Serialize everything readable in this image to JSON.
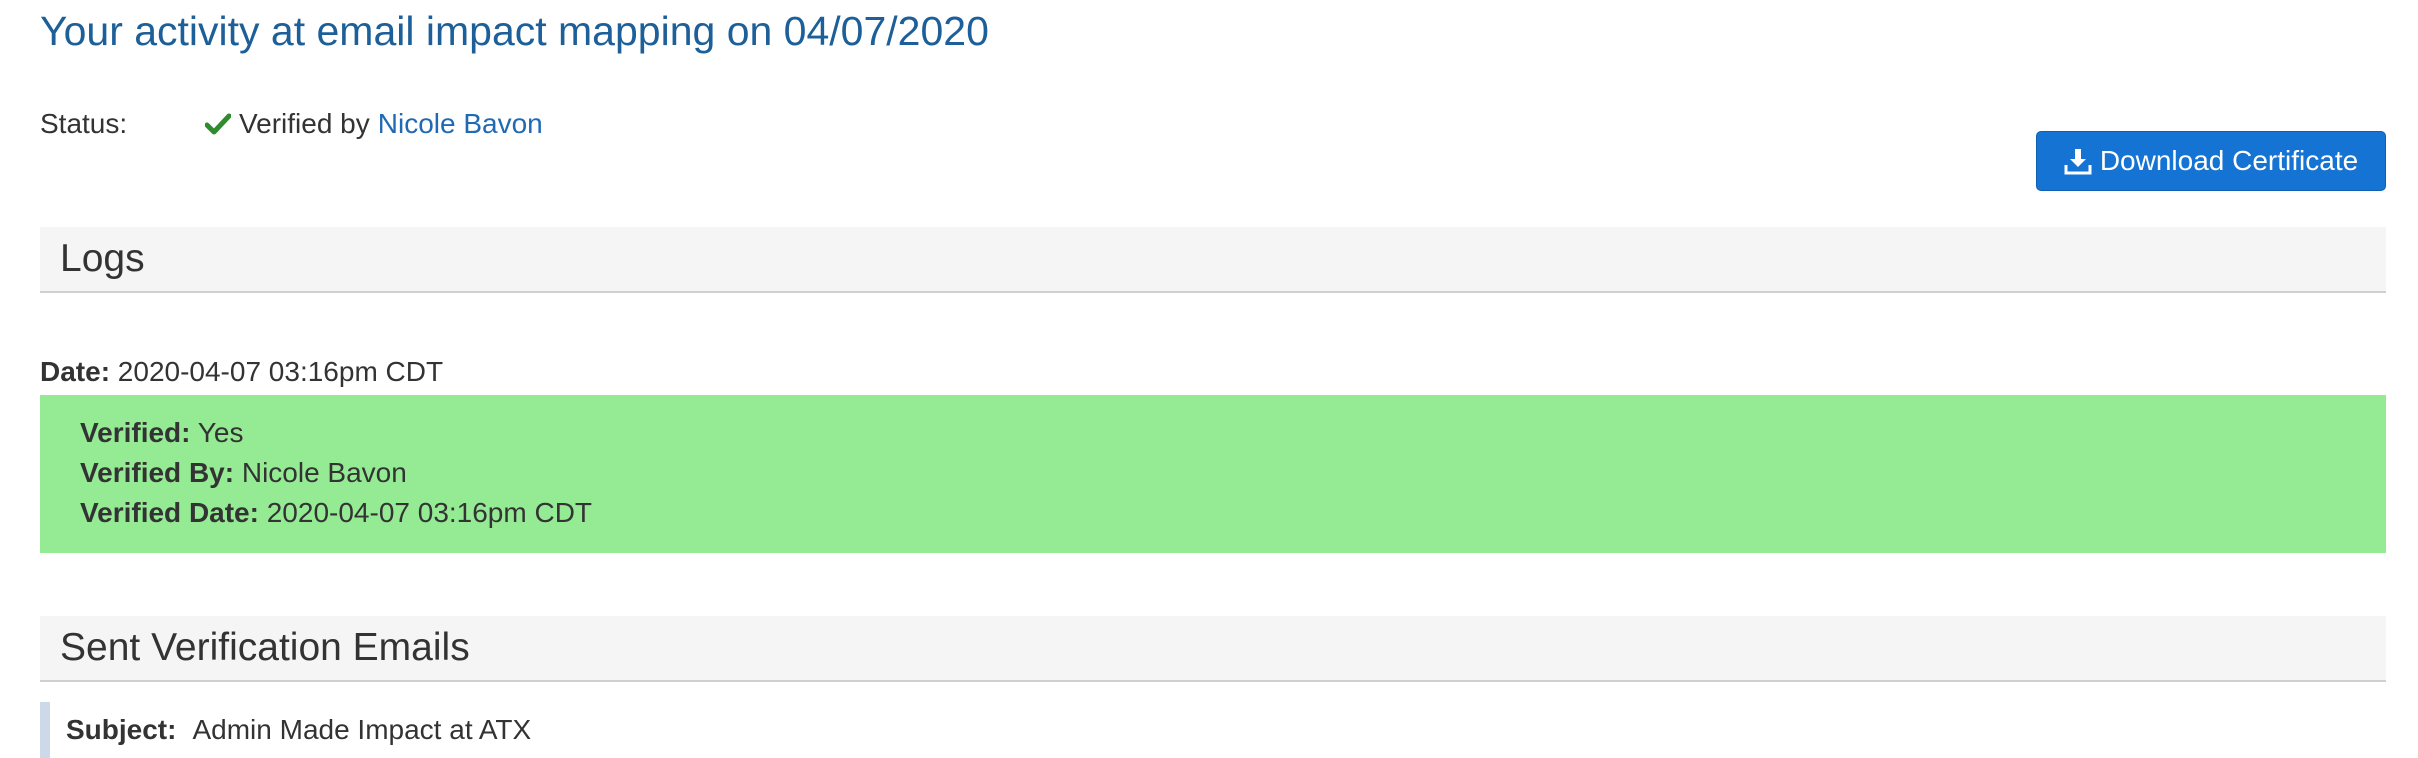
{
  "page": {
    "title": "Your activity at email impact mapping on 04/07/2020"
  },
  "status": {
    "label": "Status:",
    "text": "Verified by",
    "verifier": "Nicole Bavon",
    "icon": "check-icon",
    "icon_color": "#2e8b2e"
  },
  "actions": {
    "download_label": "Download Certificate",
    "download_icon": "download-icon",
    "button_color": "#1573d3"
  },
  "logs": {
    "heading": "Logs",
    "entries": [
      {
        "date_label": "Date:",
        "date_value": "2020-04-07 03:16pm CDT",
        "verified_label": "Verified:",
        "verified_value": "Yes",
        "verified_by_label": "Verified By:",
        "verified_by_value": "Nicole Bavon",
        "verified_date_label": "Verified Date:",
        "verified_date_value": "2020-04-07 03:16pm CDT",
        "highlight_color": "#94eb94"
      }
    ]
  },
  "emails": {
    "heading": "Sent Verification Emails",
    "items": [
      {
        "subject_label": "Subject:",
        "subject_value": "Admin Made Impact at ATX"
      }
    ]
  }
}
